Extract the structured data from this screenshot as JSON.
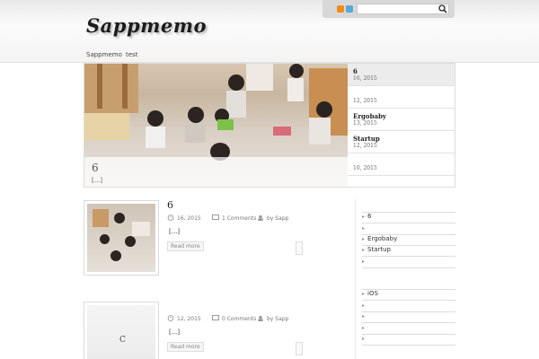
{
  "site": {
    "logo": "Sappmemo",
    "search_placeholder": ""
  },
  "nav": {
    "items": [
      "Sappmemo",
      "test"
    ]
  },
  "slider": {
    "caption_title": "6",
    "caption_text": "[...]",
    "list": [
      {
        "title": "6",
        "date": "16, 2015"
      },
      {
        "title": "",
        "date": "12, 2015"
      },
      {
        "title": "Ergobaby",
        "date": "13, 2015"
      },
      {
        "title": "Startup",
        "date": "12, 2015"
      },
      {
        "title": "",
        "date": "10, 2015"
      }
    ]
  },
  "posts": [
    {
      "title": "6",
      "date": "16, 2015",
      "comments": "1 Comments",
      "author": "by Sapp",
      "excerpt": "[...]",
      "readmore": "Read more"
    },
    {
      "title": "",
      "date": "12, 2015",
      "comments": "0 Comments",
      "author": "by Sapp",
      "excerpt": "[...]",
      "readmore": "Read more",
      "thumb_letter": "C"
    }
  ],
  "sidebar": {
    "group1": [
      "6",
      "",
      "Ergobaby",
      "Startup",
      ""
    ],
    "group2": [
      "iOS",
      "",
      "",
      "",
      ""
    ]
  },
  "colors": {
    "accent": "#f28c1c",
    "twitter": "#5aa7d8",
    "border": "#dcdcdc"
  }
}
